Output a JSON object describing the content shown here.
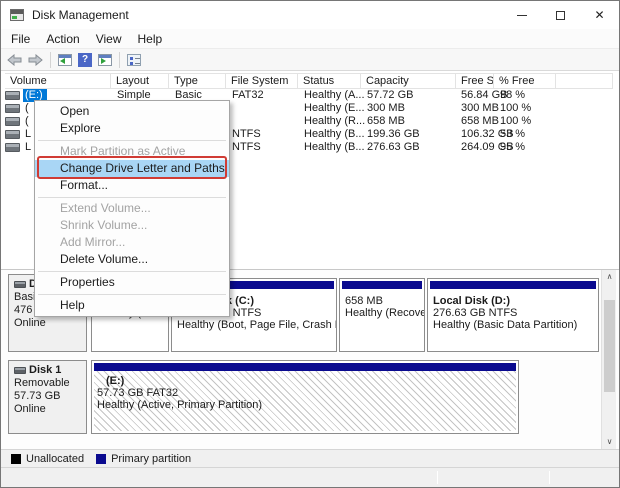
{
  "window": {
    "title": "Disk Management",
    "controls": [
      "minimize",
      "maximize",
      "close"
    ],
    "close_glyph": "✕"
  },
  "menu_bar": {
    "items": [
      "File",
      "Action",
      "View",
      "Help"
    ]
  },
  "toolbar": {
    "icons": [
      "back-arrow",
      "forward-arrow",
      "console-window-back",
      "help",
      "console-window-forward",
      "list-view"
    ]
  },
  "volume_table": {
    "columns": [
      "Volume",
      "Layout",
      "Type",
      "File System",
      "Status",
      "Capacity",
      "Free Spa...",
      "% Free"
    ],
    "rows": [
      {
        "volume": "(E:)",
        "layout": "Simple",
        "type": "Basic",
        "file_system": "FAT32",
        "status": "Healthy (A...",
        "capacity": "57.72 GB",
        "free_space": "56.84 GB",
        "pct_free": "98 %"
      },
      {
        "volume": "(",
        "layout": "",
        "type": "",
        "file_system": "",
        "status": "Healthy (E...",
        "capacity": "300 MB",
        "free_space": "300 MB",
        "pct_free": "100 %"
      },
      {
        "volume": "(",
        "layout": "",
        "type": "",
        "file_system": "",
        "status": "Healthy (R...",
        "capacity": "658 MB",
        "free_space": "658 MB",
        "pct_free": "100 %"
      },
      {
        "volume": "L",
        "layout": "",
        "type": "",
        "file_system": "NTFS",
        "status": "Healthy (B...",
        "capacity": "199.36 GB",
        "free_space": "106.32 GB",
        "pct_free": "53 %"
      },
      {
        "volume": "L",
        "layout": "",
        "type": "",
        "file_system": "NTFS",
        "status": "Healthy (B...",
        "capacity": "276.63 GB",
        "free_space": "264.09 GB",
        "pct_free": "95 %"
      }
    ]
  },
  "context_menu": {
    "items": [
      {
        "label": "Open",
        "state": "enabled"
      },
      {
        "label": "Explore",
        "state": "enabled"
      },
      {
        "label": "Mark Partition as Active",
        "state": "disabled"
      },
      {
        "label": "Change Drive Letter and Paths...",
        "state": "highlighted"
      },
      {
        "label": "Format...",
        "state": "enabled"
      },
      {
        "label": "Extend Volume...",
        "state": "disabled"
      },
      {
        "label": "Shrink Volume...",
        "state": "disabled"
      },
      {
        "label": "Add Mirror...",
        "state": "disabled"
      },
      {
        "label": "Delete Volume...",
        "state": "enabled"
      },
      {
        "label": "Properties",
        "state": "enabled"
      },
      {
        "label": "Help",
        "state": "enabled"
      }
    ],
    "annotation": "red-highlight-box"
  },
  "disks": [
    {
      "name": "Disk 0",
      "type_label": "Basic",
      "size_label": "476",
      "status_label": "Online",
      "partitions": [
        {
          "name": "",
          "size_line": "300 MB",
          "status_line": "Healthy (EFI Sy:"
        },
        {
          "name": "Local Disk (C:)",
          "size_line": "199.36 GB NTFS",
          "status_line": "Healthy (Boot, Page File, Crash Dum"
        },
        {
          "name": "",
          "size_line": "658 MB",
          "status_line": "Healthy (Recovery"
        },
        {
          "name": "Local Disk (D:)",
          "size_line": "276.63 GB NTFS",
          "status_line": "Healthy (Basic Data Partition)"
        }
      ]
    },
    {
      "name": "Disk 1",
      "type_label": "Removable",
      "size_label": "57.73 GB",
      "status_label": "Online",
      "partitions": [
        {
          "name": "(E:)",
          "size_line": "57.73 GB FAT32",
          "status_line": "Healthy (Active, Primary Partition)"
        }
      ]
    }
  ],
  "legend": {
    "items": [
      {
        "label": "Unallocated",
        "color": "#000000"
      },
      {
        "label": "Primary partition",
        "color": "#0a0a8f"
      }
    ]
  },
  "colors": {
    "selection_blue": "#0078d7",
    "menu_highlight_blue": "#a9d6f5",
    "annotation_red": "#d03b34",
    "partition_navy": "#0a0a8f"
  }
}
